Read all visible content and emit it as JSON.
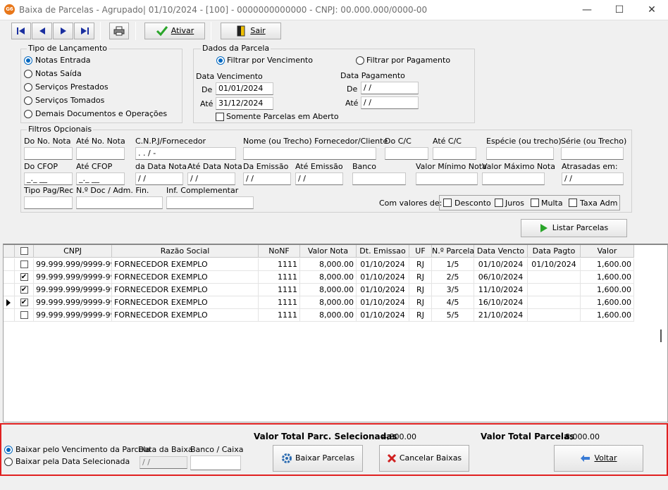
{
  "window": {
    "title": "Baixa de Parcelas - Agrupado| 01/10/2024 - [100] - 0000000000000 - CNPJ: 00.000.000/0000-00",
    "icon_text": "G6",
    "minimize": "—",
    "maximize": "☐",
    "close": "✕"
  },
  "toolbar": {
    "first_icon": "first-icon",
    "prev_icon": "prev-icon",
    "next_icon": "next-icon",
    "last_icon": "last-icon",
    "print_icon": "printer-icon",
    "ativar_label": "Ativar",
    "sair_label": "Sair"
  },
  "tipo_lancamento": {
    "title": "Tipo de Lançamento",
    "options": [
      "Notas Entrada",
      "Notas Saída",
      "Serviços Prestados",
      "Serviços Tomados",
      "Demais Documentos e Operações"
    ],
    "selected": 0
  },
  "dados_parcela": {
    "title": "Dados da Parcela",
    "filtrar_vencimento": "Filtrar por Vencimento",
    "filtrar_pagamento": "Filtrar por Pagamento",
    "data_vencimento_label": "Data Vencimento",
    "data_pagamento_label": "Data Pagamento",
    "de_label": "De",
    "ate_label": "Até",
    "venc_de": "01/01/2024",
    "venc_ate": "31/12/2024",
    "pag_de": " / /",
    "pag_ate": " / /",
    "somente_aberto": "Somente Parcelas em Aberto"
  },
  "filtros": {
    "title": "Filtros Opcionais",
    "do_no_nota": "Do No. Nota",
    "ate_no_nota": "Até No. Nota",
    "cnpj_fornecedor": "C.N.P.J/Fornecedor",
    "cnpj_value": " .  .  /  -",
    "nome_fornecedor": "Nome (ou Trecho) Fornecedor/Cliente",
    "do_cc": "Do C/C",
    "ate_cc": "Até C/C",
    "especie": "Espécie (ou trecho)",
    "serie": "Série (ou Trecho)",
    "do_cfop": "Do CFOP",
    "do_cfop_value": "_._ __",
    "ate_cfop": "Até CFOP",
    "ate_cfop_value": "_._ __",
    "da_data_nota": "da Data Nota",
    "ate_data_nota": "Até Data Nota",
    "da_emissao": "Da Emissão",
    "ate_emissao": "Até Emissão",
    "banco": "Banco",
    "valor_minimo": "Valor Mínimo Nota",
    "valor_maximo": "Valor Máximo Nota",
    "atrasadas": "Atrasadas em:",
    "tipo_pag": "Tipo Pag/Rec",
    "n_doc": "N.º Doc / Adm. Fin.",
    "inf_complementar": "Inf. Complementar",
    "empty_date": " / /",
    "com_valores": "Com valores de:",
    "desconto": "Desconto",
    "juros": "Juros",
    "multa": "Multa",
    "taxa_adm": "Taxa Adm"
  },
  "listar_label": "Listar Parcelas",
  "grid": {
    "columns": [
      "CNPJ",
      "Razão Social",
      "NoNF",
      "Valor Nota",
      "Dt. Emissao",
      "UF",
      "N.º Parcela",
      "Data Vencto",
      "Data Pagto",
      "Valor"
    ],
    "rows": [
      {
        "checked": false,
        "cnpj": "99.999.999/9999-99",
        "razao": "FORNECEDOR EXEMPLO",
        "nonf": "1111",
        "valor_nota": "8,000.00",
        "emissao": "01/10/2024",
        "uf": "RJ",
        "parcela": "1/5",
        "vencto": "01/10/2024",
        "pagto": "01/10/2024",
        "valor": "1,600.00"
      },
      {
        "checked": true,
        "cnpj": "99.999.999/9999-99",
        "razao": "FORNECEDOR EXEMPLO",
        "nonf": "1111",
        "valor_nota": "8,000.00",
        "emissao": "01/10/2024",
        "uf": "RJ",
        "parcela": "2/5",
        "vencto": "06/10/2024",
        "pagto": "",
        "valor": "1,600.00"
      },
      {
        "checked": true,
        "cnpj": "99.999.999/9999-99",
        "razao": "FORNECEDOR EXEMPLO",
        "nonf": "1111",
        "valor_nota": "8,000.00",
        "emissao": "01/10/2024",
        "uf": "RJ",
        "parcela": "3/5",
        "vencto": "11/10/2024",
        "pagto": "",
        "valor": "1,600.00"
      },
      {
        "checked": true,
        "cnpj": "99.999.999/9999-99",
        "razao": "FORNECEDOR EXEMPLO",
        "nonf": "1111",
        "valor_nota": "8,000.00",
        "emissao": "01/10/2024",
        "uf": "RJ",
        "parcela": "4/5",
        "vencto": "16/10/2024",
        "pagto": "",
        "valor": "1,600.00",
        "current": true
      },
      {
        "checked": false,
        "cnpj": "99.999.999/9999-99",
        "razao": "FORNECEDOR EXEMPLO",
        "nonf": "1111",
        "valor_nota": "8,000.00",
        "emissao": "01/10/2024",
        "uf": "RJ",
        "parcela": "5/5",
        "vencto": "21/10/2024",
        "pagto": "",
        "valor": "1,600.00"
      }
    ]
  },
  "bottom": {
    "baixar_vencimento": "Baixar pelo Vencimento da Parcela",
    "baixar_data": "Baixar pela Data Selecionada",
    "data_baixa_label": "Data da Baixa",
    "data_baixa_value": " / /",
    "banco_caixa_label": "Banco / Caixa",
    "total_selecionadas_label": "Valor Total Parc. Selecionadas",
    "total_selecionadas": "4,800.00",
    "total_parcelas_label": "Valor Total Parcelas",
    "total_parcelas": "8,000.00",
    "baixar_parcelas": "Baixar Parcelas",
    "cancelar_baixas": "Cancelar Baixas",
    "voltar": "Voltar"
  },
  "colors": {
    "accent": "#0067c0",
    "highlight_border": "#e02020",
    "check_green": "#2aa52a",
    "cancel_red": "#d02020"
  }
}
